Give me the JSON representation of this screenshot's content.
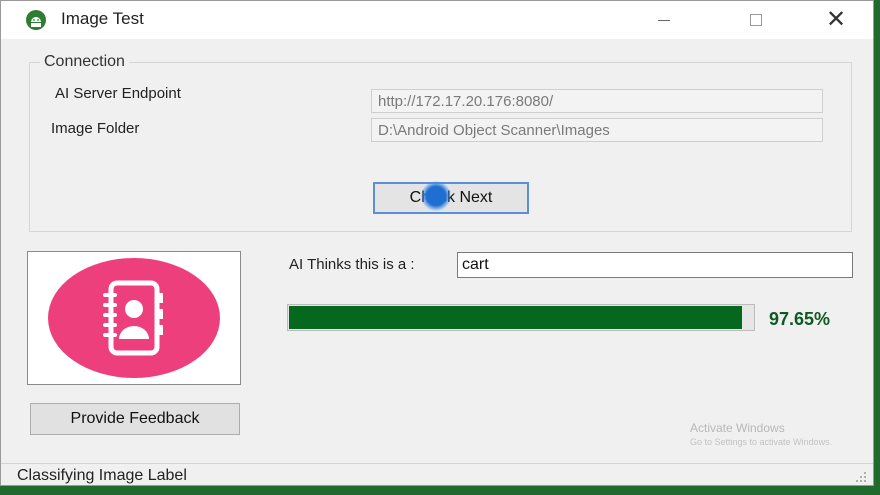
{
  "window": {
    "title": "Image Test",
    "app_icon": "android-icon"
  },
  "controls": {
    "minimize": "minimize-icon",
    "maximize": "maximize-icon",
    "close_symbol": "✕"
  },
  "connection": {
    "group_title": "Connection",
    "endpoint_label": "AI Server Endpoint",
    "endpoint_value": "http://172.17.20.176:8080/",
    "folder_label": "Image Folder",
    "folder_value": "D:\\Android Object Scanner\\Images",
    "check_button": "Check Next"
  },
  "result": {
    "prediction_label": "AI Thinks this is a :",
    "prediction_value": "cart",
    "confidence_percent": 97.65,
    "confidence_text": "97.65%",
    "image_icon": "contacts-book-icon"
  },
  "feedback_button": "Provide Feedback",
  "watermark": {
    "line1": "Activate Windows",
    "line2": "Go to Settings to activate Windows."
  },
  "status": {
    "text": "Classifying Image Label"
  },
  "colors": {
    "progress": "#06671f",
    "image_circle": "#ee3f7d",
    "percent_text": "#0f5a23"
  }
}
